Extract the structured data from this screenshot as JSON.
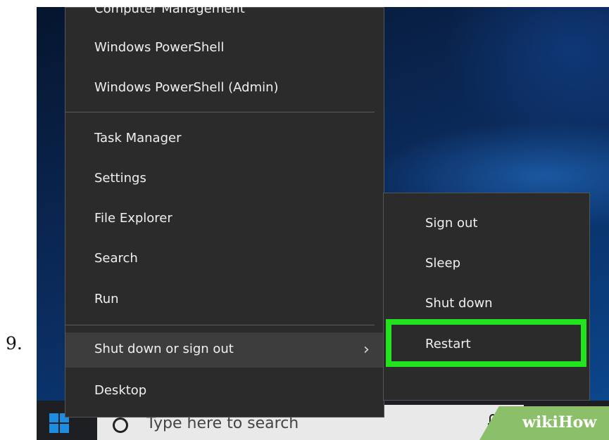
{
  "step": {
    "number": "9."
  },
  "context_menu": {
    "items": [
      {
        "label": "Computer Management"
      },
      {
        "label": "Windows PowerShell"
      },
      {
        "label": "Windows PowerShell (Admin)"
      },
      {
        "label": "Task Manager"
      },
      {
        "label": "Settings"
      },
      {
        "label": "File Explorer"
      },
      {
        "label": "Search"
      },
      {
        "label": "Run"
      },
      {
        "label": "Shut down or sign out"
      },
      {
        "label": "Desktop"
      }
    ],
    "submenu_indicator": "›"
  },
  "submenu": {
    "items": [
      {
        "label": "Sign out"
      },
      {
        "label": "Sleep"
      },
      {
        "label": "Shut down"
      },
      {
        "label": "Restart"
      }
    ],
    "highlight_color": "#23e31f"
  },
  "taskbar": {
    "search_placeholder": "Type here to search"
  },
  "watermark": {
    "text": "wikiHow"
  },
  "colors": {
    "menu_bg": "#2b2b2b",
    "menu_hover": "#3d3d3d",
    "taskbar_bg": "#1d1f22",
    "accent_blue": "#1e8de0"
  }
}
